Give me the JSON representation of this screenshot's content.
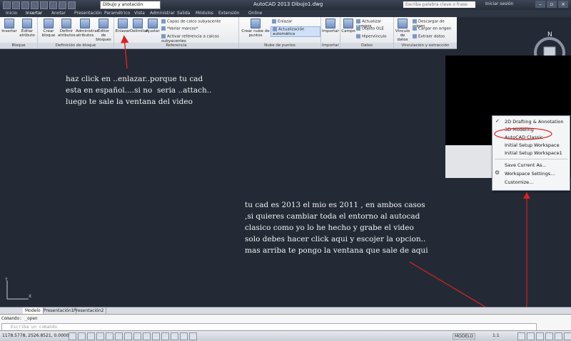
{
  "titlebar": {
    "workspace": "Dibujo y anotación",
    "title": "AutoCAD 2013   Dibujo1.dwg",
    "search_placeholder": "Escriba palabra clave o frase",
    "signin": "Iniciar sesión"
  },
  "tabs": [
    "Inicio",
    "Insertar",
    "Anotar",
    "Presentación",
    "Paramétrico",
    "Vista",
    "Administrar",
    "Salida",
    "Módulos",
    "Extensión",
    "Online"
  ],
  "ribbon": {
    "panels": {
      "bloque": {
        "title": "Bloque",
        "buttons": [
          "Insertar",
          "Editar atributo"
        ]
      },
      "definicion": {
        "title": "Definición de bloque",
        "buttons": [
          "Crear bloque",
          "Definir atributos",
          "Administrar atributos",
          "Editor de bloques"
        ]
      },
      "referencia": {
        "title": "Referencia",
        "buttons": [
          "Enlazar",
          "Delimitar",
          "Ajustar"
        ],
        "small": [
          "Capas de calco subyacente",
          "*Variar marcos*",
          "Activar referencia a calcos subyacentes"
        ]
      },
      "nube": {
        "title": "Nube de puntos",
        "buttons": [
          "Crear nube de puntos"
        ],
        "small": [
          "Enlazar",
          "Actualización automática"
        ]
      },
      "importar": {
        "title": "Importar",
        "buttons": [
          "Importar"
        ]
      },
      "datos": {
        "title": "Datos",
        "buttons": [
          "Campo"
        ],
        "small": [
          "Actualizar campos",
          "Objeto OLE",
          "Hipervínculo"
        ]
      },
      "vinculacion": {
        "title": "Vinculación y extracción",
        "buttons": [
          "Vínculo de datos"
        ],
        "small": [
          "Descargar de origen",
          "Cargar en origen",
          "Extraer datos"
        ]
      }
    }
  },
  "compass": {
    "north": "N"
  },
  "workspace_menu": {
    "items": [
      {
        "label": "2D Drafting & Annotation",
        "checked": true
      },
      {
        "label": "3D Modeling",
        "checked": false
      },
      {
        "label": "AutoCAD Classic",
        "checked": false,
        "circled": true
      },
      {
        "label": "Initial Setup Workspace",
        "checked": false
      },
      {
        "label": "Initial Setup Workspace1",
        "checked": false
      }
    ],
    "actions": [
      "Save Current As...",
      "Workspace Settings...",
      "Customize..."
    ]
  },
  "annotations": {
    "note1": "haz click en ..enlazar..porque tu cad\nesta en español....si no  seria ..attach..\nluego te sale la ventana del video",
    "note2": "tu cad es 2013 el mio es 2011 , en ambos casos\n,si quieres cambiar toda el entorno al autocad\nclasico como yo lo he hecho y grabe el video\nsolo debes hacer click aqui y escojer la opcion..\nmas arriba te pongo la ventana que sale de aqui",
    "arrow_color": "#e0201c"
  },
  "ucs": {
    "x": "X",
    "y": "Y"
  },
  "layout_tabs": [
    "Modelo",
    "Presentación1",
    "Presentación2"
  ],
  "command": {
    "history": "Comando: _open",
    "placeholder": "Escriba un comando"
  },
  "statusbar": {
    "coords": "1178.5778, 2526.8521, 0.0000",
    "model": "MODELO",
    "scale": "1:1"
  }
}
